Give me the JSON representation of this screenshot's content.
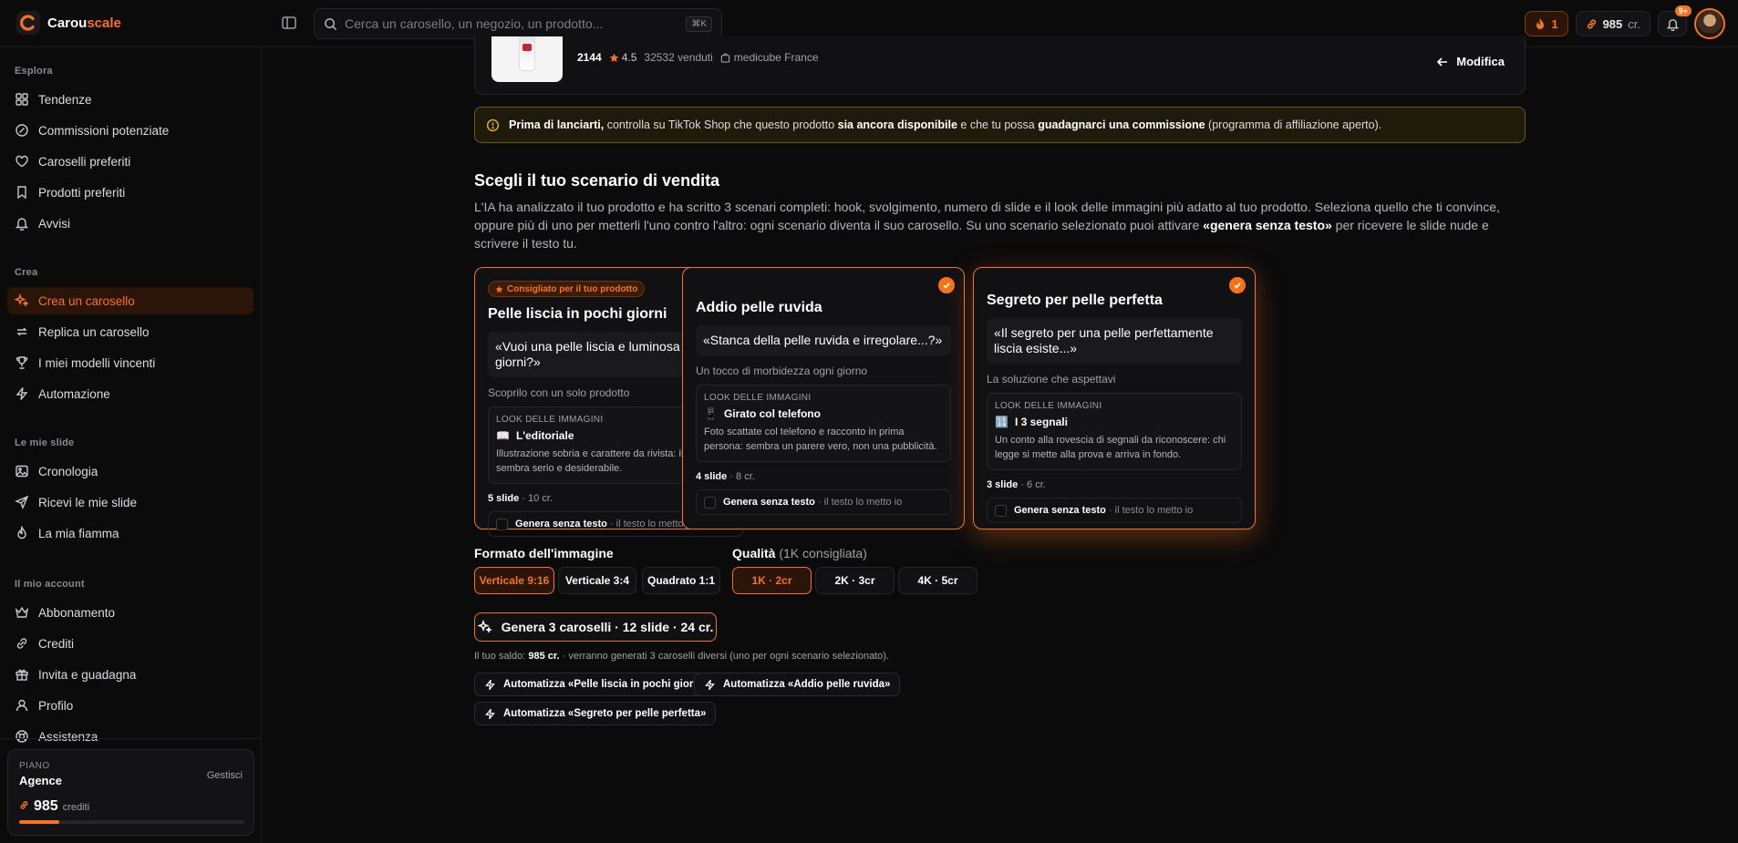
{
  "app": {
    "logo_part1": "Carou",
    "logo_part2": "scale"
  },
  "search": {
    "placeholder": "Cerca un carosello, un negozio, un prodotto...",
    "shortcut": "⌘K"
  },
  "topbar": {
    "streak": "1",
    "credits": "985",
    "credits_unit": "cr.",
    "notifications": "9+"
  },
  "sidebar": {
    "sections": [
      {
        "title": "Esplora",
        "items": [
          "Tendenze",
          "Commissioni potenziate",
          "Caroselli preferiti",
          "Prodotti preferiti",
          "Avvisi"
        ]
      },
      {
        "title": "Crea",
        "items": [
          "Crea un carosello",
          "Replica un carosello",
          "I miei modelli vincenti",
          "Automazione"
        ]
      },
      {
        "title": "Le mie slide",
        "items": [
          "Cronologia",
          "Ricevi le mie slide",
          "La mia fiamma"
        ]
      },
      {
        "title": "Il mio account",
        "items": [
          "Abbonamento",
          "Crediti",
          "Invita e guadagna",
          "Profilo",
          "Assistenza"
        ]
      }
    ],
    "active_item": "Crea un carosello",
    "plan": {
      "label": "PIANO",
      "name": "Agence",
      "manage": "Gestisci",
      "credits": "985",
      "credits_unit": "crediti",
      "usage_fraction": 0.18
    }
  },
  "product": {
    "id": "2144",
    "rating": "4.5",
    "sold": "32532 venduti",
    "shop": "medicube France",
    "modify": "Modifica"
  },
  "warning": {
    "b1": "Prima di lanciarti,",
    "t1": " controlla su TikTok Shop che questo prodotto ",
    "b2": "sia ancora disponibile",
    "t2": " e che tu possa ",
    "b3": "guadagnarci una commissione",
    "t3": " (programma di affiliazione aperto)."
  },
  "heading": {
    "title": "Scegli il tuo scenario di vendita",
    "desc_1": "L'IA ha analizzato il tuo prodotto e ha scritto 3 scenari completi: hook, svolgimento, numero di slide e il look delle immagini più adatto al tuo prodotto. Seleziona quello che ti convince, oppure più di uno per metterli l'uno contro l'altro: ogni scenario diventa il suo carosello. Su uno scenario selezionato puoi attivare ",
    "desc_bold": "«genera senza testo»",
    "desc_2": " per ricevere le slide nude e scrivere il testo tu."
  },
  "look_label": "LOOK DELLE IMMAGINI",
  "nogen_label": "Genera senza testo",
  "nogen_hint": " · il testo lo metto io",
  "slides_word": " slide",
  "scenarios": [
    {
      "badge": "Consigliato per il tuo prodotto",
      "title": "Pelle liscia in pochi giorni",
      "hook": "«Vuoi una pelle liscia e luminosa in pochi giorni?»",
      "subtitle": "Scoprilo con un solo prodotto",
      "look_emoji": "📖",
      "look_name": "L'editoriale",
      "look_desc": "Illustrazione sobria e carattere da rivista: il prodotto sembra serio e desiderabile.",
      "slides": "5",
      "cost": " · 10 cr."
    },
    {
      "title": "Addio pelle ruvida",
      "hook": "«Stanca della pelle ruvida e irregolare...?»",
      "subtitle": "Un tocco di morbidezza ogni giorno",
      "look_emoji": "📱",
      "look_name": "Girato col telefono",
      "look_desc": "Foto scattate col telefono e racconto in prima persona: sembra un parere vero, non una pubblicità.",
      "slides": "4",
      "cost": " · 8 cr."
    },
    {
      "title": "Segreto per pelle perfetta",
      "hook": "«Il segreto per una pelle perfettamente liscia esiste...»",
      "subtitle": "La soluzione che aspettavi",
      "look_emoji": "🔢",
      "look_name": "I 3 segnali",
      "look_desc": "Un conto alla rovescia di segnali da riconoscere: chi legge si mette alla prova e arriva in fondo.",
      "slides": "3",
      "cost": " · 6 cr."
    }
  ],
  "format": {
    "label": "Formato dell'immagine",
    "options": [
      "Verticale 9:16",
      "Verticale 3:4",
      "Quadrato 1:1"
    ],
    "selected": "Verticale 9:16"
  },
  "quality": {
    "label": "Qualità",
    "hint": "(1K consigliata)",
    "options": [
      "1K · 2cr",
      "2K · 3cr",
      "4K · 5cr"
    ],
    "selected": "1K · 2cr"
  },
  "generate_button": "Genera 3 caroselli · 12 slide · 24 cr.",
  "balance": {
    "prefix": "Il tuo saldo: ",
    "amount": "985 cr.",
    "suffix": " · verranno generati 3 caroselli diversi (uno per ogni scenario selezionato)."
  },
  "automations": [
    "Automatizza «Pelle liscia in pochi giorni»",
    "Automatizza «Addio pelle ruvida»",
    "Automatizza «Segreto per pelle perfetta»"
  ],
  "colors": {
    "accent": "#f97316",
    "background": "#0b0b0c",
    "warning_border": "#6b5a14"
  }
}
